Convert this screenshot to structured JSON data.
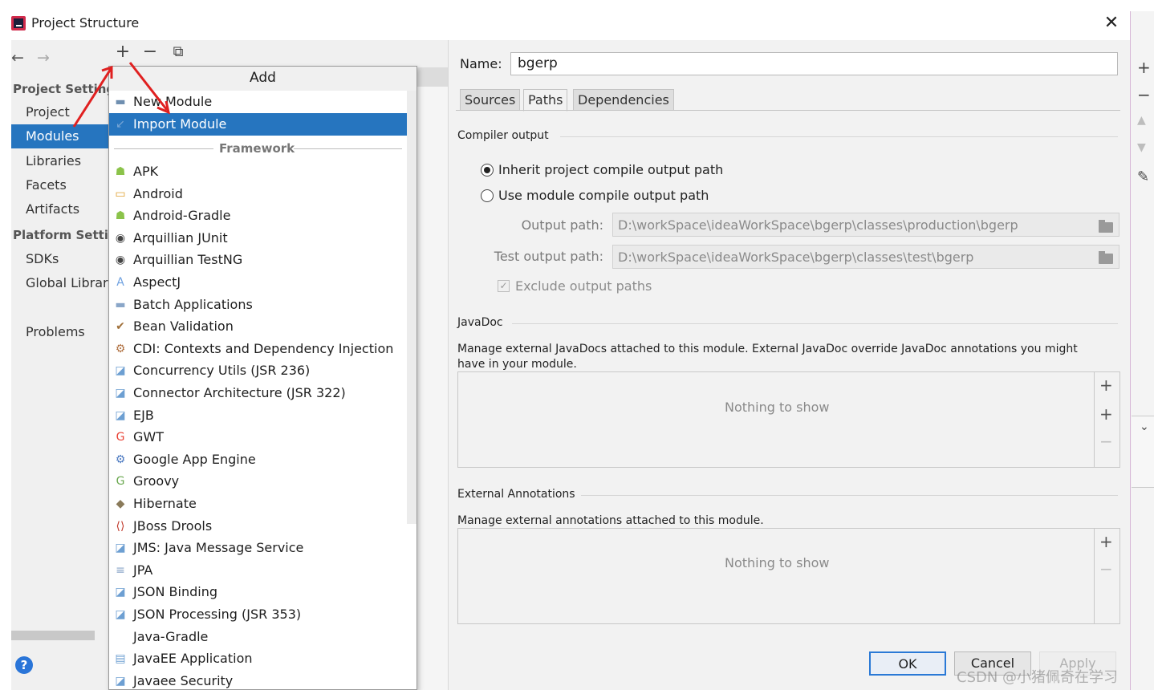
{
  "window": {
    "title": "Project Structure",
    "close_glyph": "✕"
  },
  "toolbar": {
    "back": "←",
    "forward": "→",
    "add": "+",
    "remove": "−",
    "copy": "⧉"
  },
  "sidebar": {
    "project_settings_heading": "Project Settings",
    "project_items": [
      "Project",
      "Modules",
      "Libraries",
      "Facets",
      "Artifacts"
    ],
    "platform_settings_heading": "Platform Settings",
    "platform_items": [
      "SDKs",
      "Global Libraries"
    ],
    "problems": "Problems",
    "selected": "Modules",
    "help_glyph": "?"
  },
  "popup": {
    "title": "Add",
    "items": [
      {
        "label": "New Module",
        "icon": "module-icon",
        "color": "#6f8fb0"
      },
      {
        "label": "Import Module",
        "icon": "import-module-icon",
        "color": "#7aa7d6",
        "selected": true
      }
    ],
    "framework_heading": "Framework",
    "frameworks": [
      {
        "label": "APK",
        "icon": "android-icon",
        "color": "#8bc34a"
      },
      {
        "label": "Android",
        "icon": "android-folder-icon",
        "color": "#e0a030"
      },
      {
        "label": "Android-Gradle",
        "icon": "android-icon",
        "color": "#8bc34a"
      },
      {
        "label": "Arquillian JUnit",
        "icon": "arquillian-icon",
        "color": "#444444"
      },
      {
        "label": "Arquillian TestNG",
        "icon": "arquillian-icon",
        "color": "#444444"
      },
      {
        "label": "AspectJ",
        "icon": "aspectj-icon",
        "color": "#6ea0e0"
      },
      {
        "label": "Batch Applications",
        "icon": "batch-icon",
        "color": "#8aa6c8"
      },
      {
        "label": "Bean Validation",
        "icon": "bean-validation-icon",
        "color": "#a0703a"
      },
      {
        "label": "CDI: Contexts and Dependency Injection",
        "icon": "cdi-icon",
        "color": "#b07040"
      },
      {
        "label": "Concurrency Utils (JSR 236)",
        "icon": "jee-icon",
        "color": "#6d9fd2"
      },
      {
        "label": "Connector Architecture (JSR 322)",
        "icon": "jee-icon",
        "color": "#6d9fd2"
      },
      {
        "label": "EJB",
        "icon": "jee-icon",
        "color": "#6d9fd2"
      },
      {
        "label": "GWT",
        "icon": "gwt-icon",
        "color": "#e94235"
      },
      {
        "label": "Google App Engine",
        "icon": "app-engine-icon",
        "color": "#4a78c0"
      },
      {
        "label": "Groovy",
        "icon": "groovy-icon",
        "color": "#6aa84f"
      },
      {
        "label": "Hibernate",
        "icon": "hibernate-icon",
        "color": "#8a7a5a"
      },
      {
        "label": "JBoss Drools",
        "icon": "drools-icon",
        "color": "#c0392b"
      },
      {
        "label": "JMS: Java Message Service",
        "icon": "jee-icon",
        "color": "#6d9fd2"
      },
      {
        "label": "JPA",
        "icon": "jpa-icon",
        "color": "#8aa6c8"
      },
      {
        "label": "JSON Binding",
        "icon": "jee-icon",
        "color": "#6d9fd2"
      },
      {
        "label": "JSON Processing (JSR 353)",
        "icon": "jee-icon",
        "color": "#6d9fd2"
      },
      {
        "label": "Java-Gradle",
        "icon": "",
        "color": "#ffffff"
      },
      {
        "label": "JavaEE Application",
        "icon": "javaee-app-icon",
        "color": "#6d9fd2"
      },
      {
        "label": "Javaee Security",
        "icon": "jee-icon",
        "color": "#6d9fd2"
      }
    ]
  },
  "module": {
    "name_label": "Name:",
    "name_value": "bgerp",
    "tabs": [
      "Sources",
      "Paths",
      "Dependencies"
    ],
    "active_tab": "Paths",
    "compiler_output_title": "Compiler output",
    "inherit_option": "Inherit project compile output path",
    "use_module_option": "Use module compile output path",
    "output_path_label": "Output path:",
    "output_path_value": "D:\\workSpace\\ideaWorkSpace\\bgerp\\classes\\production\\bgerp",
    "test_output_path_label": "Test output path:",
    "test_output_path_value": "D:\\workSpace\\ideaWorkSpace\\bgerp\\classes\\test\\bgerp",
    "exclude_output_label": "Exclude output paths",
    "javadoc_title": "JavaDoc",
    "javadoc_desc": "Manage external JavaDocs attached to this module. External JavaDoc override JavaDoc annotations you might have in your module.",
    "javadoc_empty": "Nothing to show",
    "ext_annotations_title": "External Annotations",
    "ext_annotations_desc": "Manage external annotations attached to this module.",
    "ext_annotations_empty": "Nothing to show"
  },
  "buttons": {
    "ok": "OK",
    "cancel": "Cancel",
    "apply": "Apply"
  },
  "watermark": "CSDN @小猪佩奇在学习",
  "colors": {
    "selection": "#2675bf",
    "annotation_arrow": "#e02020"
  }
}
